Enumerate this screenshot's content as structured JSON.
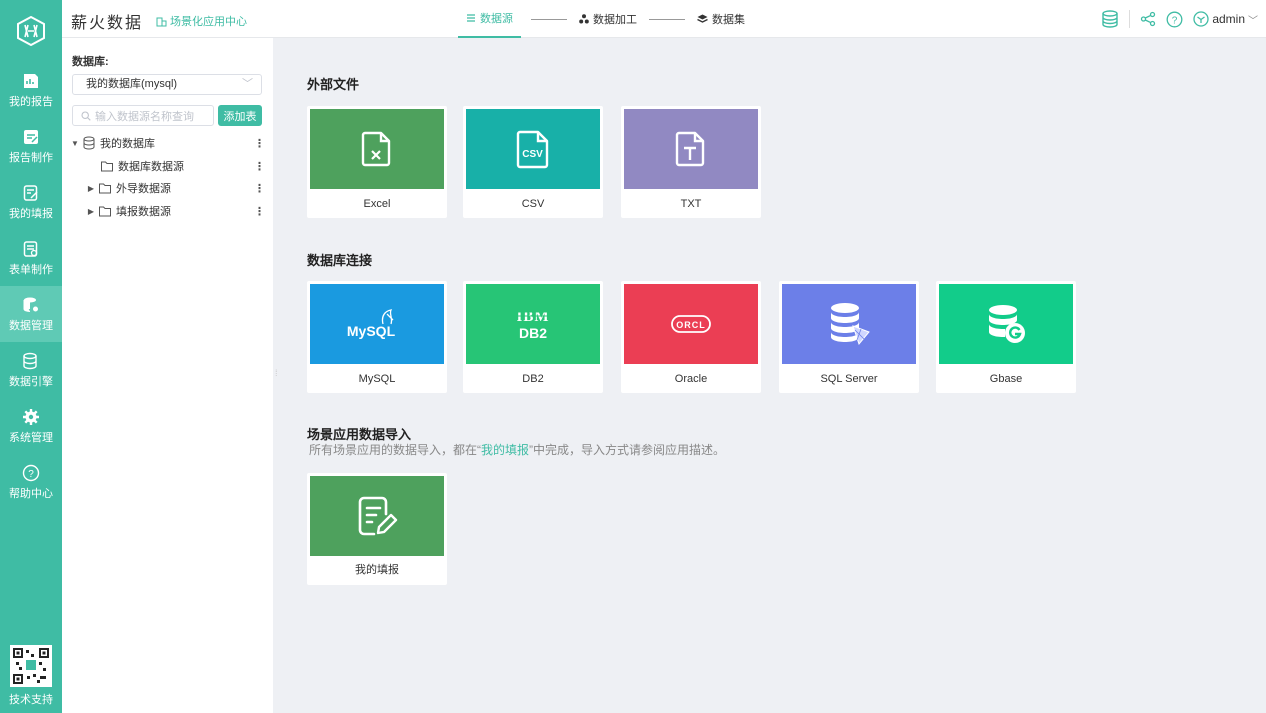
{
  "brand": {
    "title": "薪火数据",
    "scene_link": "场景化应用中心"
  },
  "steps": [
    {
      "label": "数据源",
      "icon": "list-icon",
      "active": true
    },
    {
      "label": "数据加工",
      "icon": "nodes-icon",
      "active": false
    },
    {
      "label": "数据集",
      "icon": "layers-icon",
      "active": false
    }
  ],
  "topright": {
    "user": "admin"
  },
  "sidenav": {
    "items": [
      {
        "label": "我的报告",
        "icon": "report-chart-icon"
      },
      {
        "label": "报告制作",
        "icon": "report-edit-icon"
      },
      {
        "label": "我的填报",
        "icon": "form-fill-icon"
      },
      {
        "label": "表单制作",
        "icon": "form-design-icon"
      },
      {
        "label": "数据管理",
        "icon": "database-gear-icon",
        "active": true
      },
      {
        "label": "数据引擎",
        "icon": "database-engine-icon"
      },
      {
        "label": "系统管理",
        "icon": "gear-icon"
      },
      {
        "label": "帮助中心",
        "icon": "help-icon"
      }
    ],
    "support_label": "技术支持"
  },
  "tree_panel": {
    "db_label": "数据库:",
    "db_select": "我的数据库(mysql)",
    "search_placeholder": "输入数据源名称查询",
    "add_button": "添加表",
    "tree": [
      {
        "label": "我的数据库",
        "level": 0,
        "expanded": true
      },
      {
        "label": "数据库数据源",
        "level": 1
      },
      {
        "label": "外导数据源",
        "level": 1
      },
      {
        "label": "填报数据源",
        "level": 1
      }
    ]
  },
  "main": {
    "section_files": "外部文件",
    "files": [
      {
        "label": "Excel",
        "color": "#4ea15d"
      },
      {
        "label": "CSV",
        "color": "#18b0a8"
      },
      {
        "label": "TXT",
        "color": "#9189c2"
      }
    ],
    "section_db": "数据库连接",
    "databases": [
      {
        "label": "MySQL",
        "color": "#1a9ae0"
      },
      {
        "label": "DB2",
        "color": "#27c576"
      },
      {
        "label": "Oracle",
        "color": "#eb3e54"
      },
      {
        "label": "SQL Server",
        "color": "#6c7fe8"
      },
      {
        "label": "Gbase",
        "color": "#12cc8a"
      }
    ],
    "section_scene": "场景应用数据导入",
    "scene_desc_pre": "所有场景应用的数据导入，都在“",
    "scene_desc_hl": "我的填报",
    "scene_desc_post": "”中完成，导入方式请参阅应用描述。",
    "scene": [
      {
        "label": "我的填报",
        "color": "#4ea15d"
      }
    ]
  }
}
